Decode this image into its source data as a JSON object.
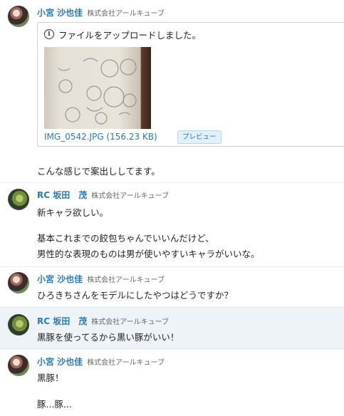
{
  "messages": [
    {
      "sender": "小宮 沙也佳",
      "org": "株式会社アールキューブ",
      "attachment": {
        "notice": "ファイルをアップロードしました。",
        "file_name": "IMG_0542.JPG (156.23 KB)",
        "preview_label": "プレビュー"
      },
      "lines": [
        "こんな感じで案出ししてます。"
      ]
    },
    {
      "sender": "RC 坂田　茂",
      "org": "株式会社アールキューブ",
      "lines": [
        "新キャラ欲しい。",
        "基本これまでの餃包ちゃんでいいんだけど、",
        "男性的な表現のものは男が使いやすいキャラがいいな。"
      ]
    },
    {
      "sender": "小宮 沙也佳",
      "org": "株式会社アールキューブ",
      "lines": [
        "ひろきちさんをモデルにしたやつはどうですか？"
      ]
    },
    {
      "sender": "RC 坂田　茂",
      "org": "株式会社アールキューブ",
      "lines": [
        "黒豚を使ってるから黒い豚がいい！"
      ]
    },
    {
      "sender": "小宮 沙也佳",
      "org": "株式会社アールキューブ",
      "lines": [
        "黒豚！",
        "豚...豚..."
      ]
    }
  ]
}
